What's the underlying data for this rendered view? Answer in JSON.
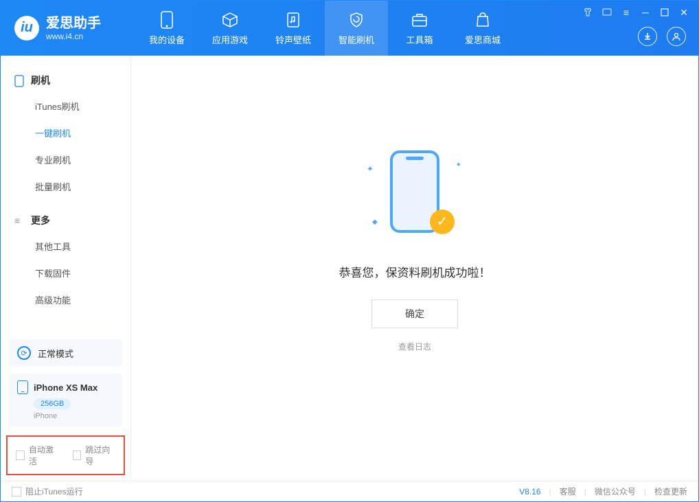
{
  "logo": {
    "title": "爱思助手",
    "subtitle": "www.i4.cn",
    "glyph": "iu"
  },
  "nav": [
    {
      "label": "我的设备"
    },
    {
      "label": "应用游戏"
    },
    {
      "label": "铃声壁纸"
    },
    {
      "label": "智能刷机"
    },
    {
      "label": "工具箱"
    },
    {
      "label": "爱思商城"
    }
  ],
  "sidebar": {
    "group1": {
      "header": "刷机",
      "items": [
        "iTunes刷机",
        "一键刷机",
        "专业刷机",
        "批量刷机"
      ]
    },
    "group2": {
      "header": "更多",
      "items": [
        "其他工具",
        "下载固件",
        "高级功能"
      ]
    }
  },
  "device_panel": {
    "mode": "正常模式",
    "name": "iPhone XS Max",
    "storage": "256GB",
    "type": "iPhone"
  },
  "options": {
    "auto_activate": "自动激活",
    "skip_guide": "跳过向导"
  },
  "main": {
    "success_text": "恭喜您，保资料刷机成功啦！",
    "ok_btn": "确定",
    "log_link": "查看日志"
  },
  "footer": {
    "block_itunes": "阻止iTunes运行",
    "version": "V8.16",
    "links": [
      "客服",
      "微信公众号",
      "检查更新"
    ]
  }
}
